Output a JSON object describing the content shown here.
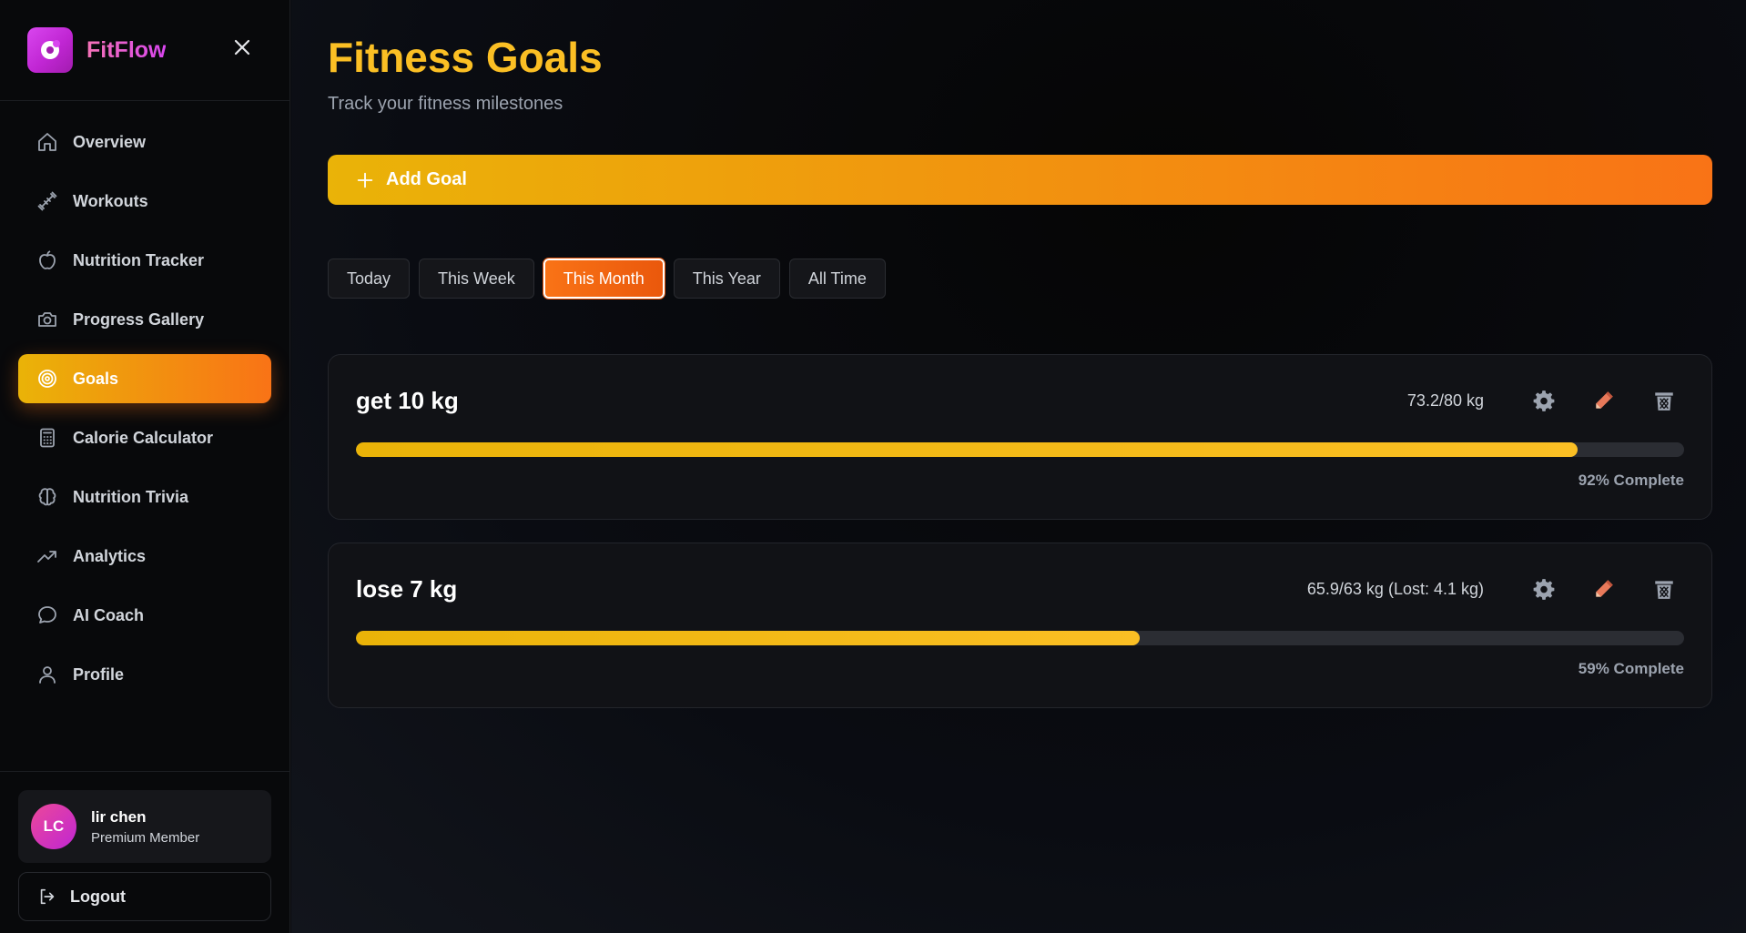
{
  "app": {
    "name": "FitFlow"
  },
  "sidebar": {
    "items": [
      {
        "label": "Overview",
        "icon": "home-icon"
      },
      {
        "label": "Workouts",
        "icon": "dumbbell-icon"
      },
      {
        "label": "Nutrition Tracker",
        "icon": "apple-icon"
      },
      {
        "label": "Progress Gallery",
        "icon": "camera-icon"
      },
      {
        "label": "Goals",
        "icon": "target-icon",
        "active": true
      },
      {
        "label": "Calorie Calculator",
        "icon": "calculator-icon"
      },
      {
        "label": "Nutrition Trivia",
        "icon": "brain-icon"
      },
      {
        "label": "Analytics",
        "icon": "trending-up-icon"
      },
      {
        "label": "AI Coach",
        "icon": "chat-bubble-icon"
      },
      {
        "label": "Profile",
        "icon": "user-icon"
      }
    ]
  },
  "user": {
    "initials": "LC",
    "name": "lir chen",
    "role": "Premium Member"
  },
  "logout_label": "Logout",
  "page": {
    "title": "Fitness Goals",
    "subtitle": "Track your fitness milestones",
    "add_goal_label": "Add Goal"
  },
  "filters": {
    "options": [
      "Today",
      "This Week",
      "This Month",
      "This Year",
      "All Time"
    ],
    "selected": "This Month"
  },
  "goals": [
    {
      "title": "get 10 kg",
      "stat": "73.2/80 kg",
      "progress": 0.92,
      "percent_label": "92% Complete"
    },
    {
      "title": "lose 7 kg",
      "stat": "65.9/63 kg (Lost: 4.1 kg)",
      "progress": 0.59,
      "percent_label": "59% Complete"
    }
  ],
  "colors": {
    "accent_start": "#eab308",
    "accent_end": "#f97316",
    "title": "#fbbf24",
    "brand": "#d946ef"
  }
}
